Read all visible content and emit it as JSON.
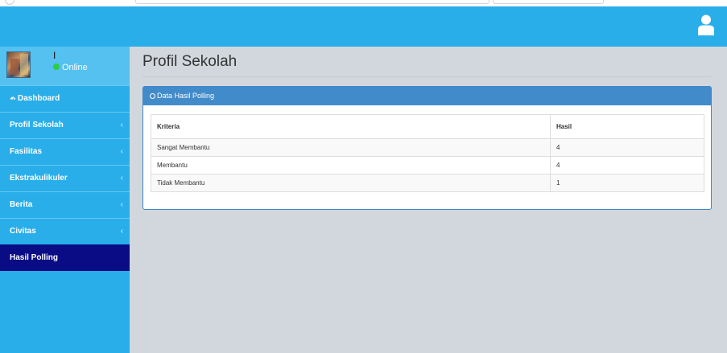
{
  "header": {
    "user_icon": "user-icon"
  },
  "sidebar": {
    "user": {
      "name": "I",
      "status": "Online"
    },
    "items": [
      {
        "label": "Dashboard",
        "icon": "dashboard-icon",
        "chevron": ""
      },
      {
        "label": "Profil Sekolah",
        "chevron": "‹"
      },
      {
        "label": "Fasilitas",
        "chevron": "‹"
      },
      {
        "label": "Ekstrakulikuler",
        "chevron": "‹"
      },
      {
        "label": "Berita",
        "chevron": "‹"
      },
      {
        "label": "Civitas",
        "chevron": "‹"
      },
      {
        "label": "Hasil Polling",
        "chevron": ""
      }
    ]
  },
  "main": {
    "page_title": "Profil Sekolah",
    "panel": {
      "heading": "Data Hasil Polling",
      "table": {
        "headers": [
          "Kriteria",
          "Hasil"
        ],
        "rows": [
          [
            "Sangat Membantu",
            "4"
          ],
          [
            "Membantu",
            "4"
          ],
          [
            "Tidak Membantu",
            "1"
          ]
        ]
      }
    }
  },
  "colors": {
    "topbar": "#29aee9",
    "sidebar": "#29aee9",
    "active_item": "#0a0c85",
    "panel_heading": "#428bca",
    "content_bg": "#d1d7dd"
  }
}
